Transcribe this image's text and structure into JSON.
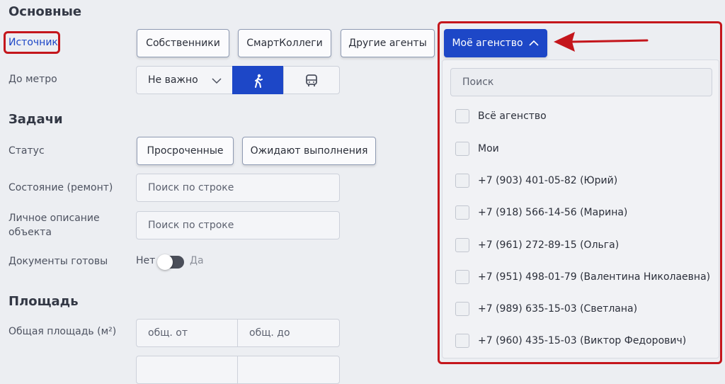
{
  "sections": {
    "main": "Основные",
    "tasks": "Задачи",
    "area": "Площадь"
  },
  "source": {
    "label": "Источник",
    "buttons": [
      "Собственники",
      "СмартКоллеги",
      "Другие агенты"
    ],
    "agency_button": "Моё агенство"
  },
  "metro": {
    "label": "До метро",
    "select_value": "Не важно",
    "options_icons": [
      "walk-icon",
      "bus-icon"
    ]
  },
  "status": {
    "label": "Статус",
    "buttons": [
      "Просроченные",
      "Ожидают выполнения"
    ]
  },
  "condition": {
    "label": "Состояние (ремонт)",
    "placeholder": "Поиск по строке"
  },
  "description": {
    "label_line1": "Личное описание",
    "label_line2": "объекта",
    "placeholder": "Поиск по строке"
  },
  "documents": {
    "label": "Документы готовы",
    "off_label": "Нет",
    "on_label": "Да"
  },
  "total_area": {
    "label": "Общая площадь (м²)",
    "from_placeholder": "общ. от",
    "to_placeholder": "общ. до"
  },
  "dropdown": {
    "search_placeholder": "Поиск",
    "options": [
      "Всё агенство",
      "Мои",
      "+7 (903) 401-05-82 (Юрий)",
      "+7 (918) 566-14-56 (Марина)",
      "+7 (961) 272-89-15 (Ольга)",
      "+7 (951) 498-01-79 (Валентина Николаевна)",
      "+7 (989) 635-15-03 (Светлана)",
      "+7 (960) 435-15-03 (Виктор Федорович)"
    ]
  },
  "colors": {
    "accent": "#1d47c7",
    "highlight": "#c4161c",
    "link": "#1d47c7"
  }
}
